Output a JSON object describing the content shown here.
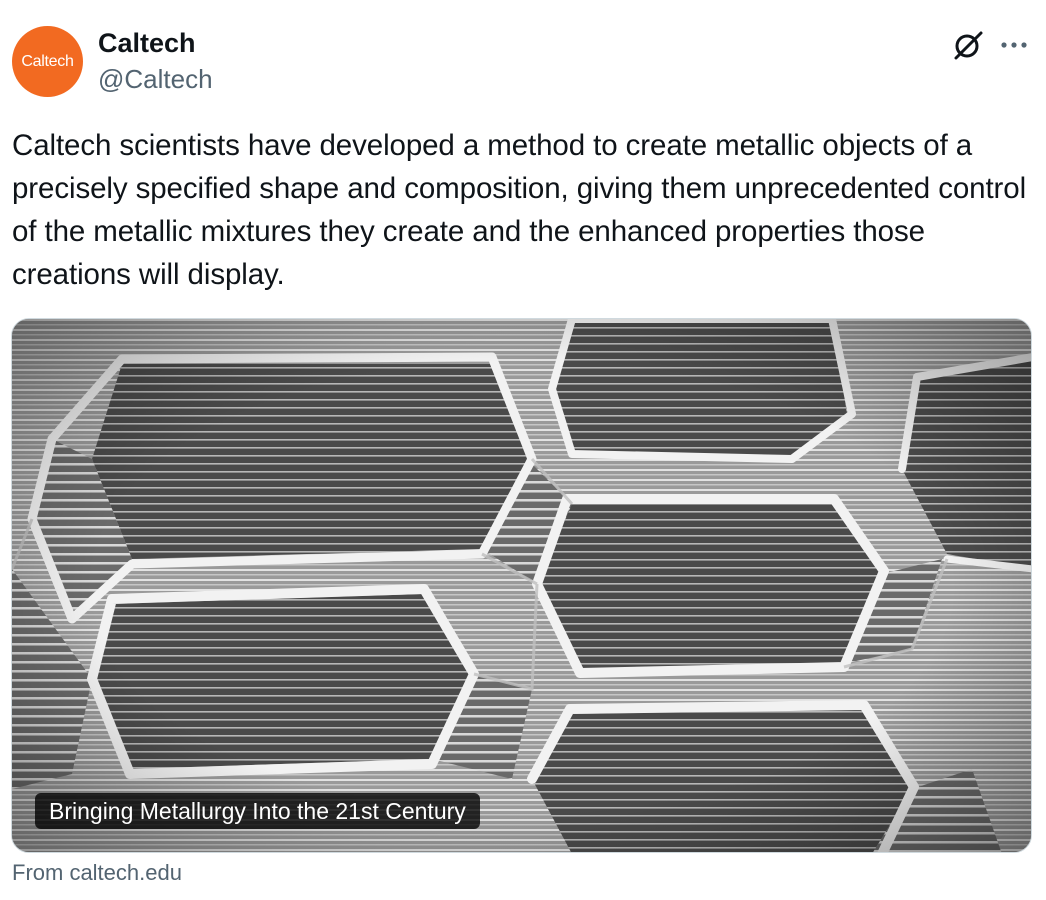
{
  "author": {
    "avatar_text": "Caltech",
    "display_name": "Caltech",
    "handle": "@Caltech",
    "brand_color": "#f26a21"
  },
  "icons": {
    "grok": "grok-icon",
    "more": "more-options-icon"
  },
  "tweet": {
    "text": "Caltech scientists have developed a method to create metallic objects of a precisely specified shape and composition, giving them unprecedented control of the metallic mixtures they create and the enhanced properties those creations will display."
  },
  "card": {
    "image_description_icon": "sem-image",
    "caption": "Bringing Metallurgy Into the 21st Century",
    "source": "From caltech.edu"
  },
  "colors": {
    "text_primary": "#0f1419",
    "text_secondary": "#536471"
  }
}
